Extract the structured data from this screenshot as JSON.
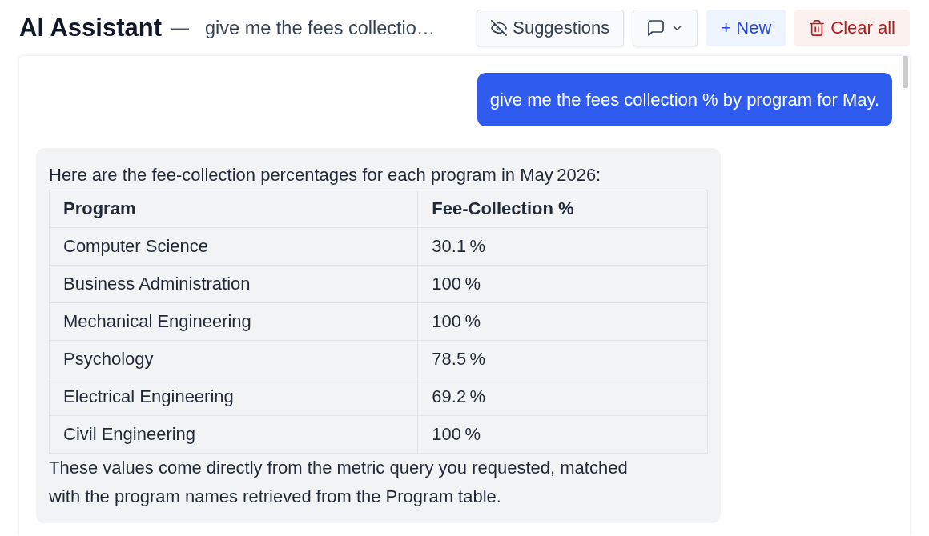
{
  "header": {
    "title": "AI Assistant",
    "separator": "—",
    "conversation_title": "give me the fees collectio…"
  },
  "toolbar": [
    {
      "kind": "toggle",
      "label": "Suggestions"
    },
    {
      "kind": "menu"
    },
    {
      "kind": "create",
      "label": "+ New"
    },
    {
      "kind": "danger",
      "label": "Clear all"
    }
  ],
  "messages": [
    {
      "kind": "user",
      "text": "give me the fees collection % by program for May."
    },
    {
      "kind": "assistant",
      "intro": "Here are the fee-collection percentages for each program in May 2026:",
      "table": {
        "columns": [
          "Program",
          "Fee-Collection %"
        ],
        "rows": [
          [
            "Computer Science",
            "30.1 %"
          ],
          [
            "Business Administration",
            "100 %"
          ],
          [
            "Mechanical Engineering",
            "100 %"
          ],
          [
            "Psychology",
            "78.5 %"
          ],
          [
            "Electrical Engineering",
            "69.2 %"
          ],
          [
            "Civil Engineering",
            "100 %"
          ]
        ]
      },
      "outro": "These values come directly from the metric query you requested, matched with the program names retrieved from the Program table."
    }
  ]
}
